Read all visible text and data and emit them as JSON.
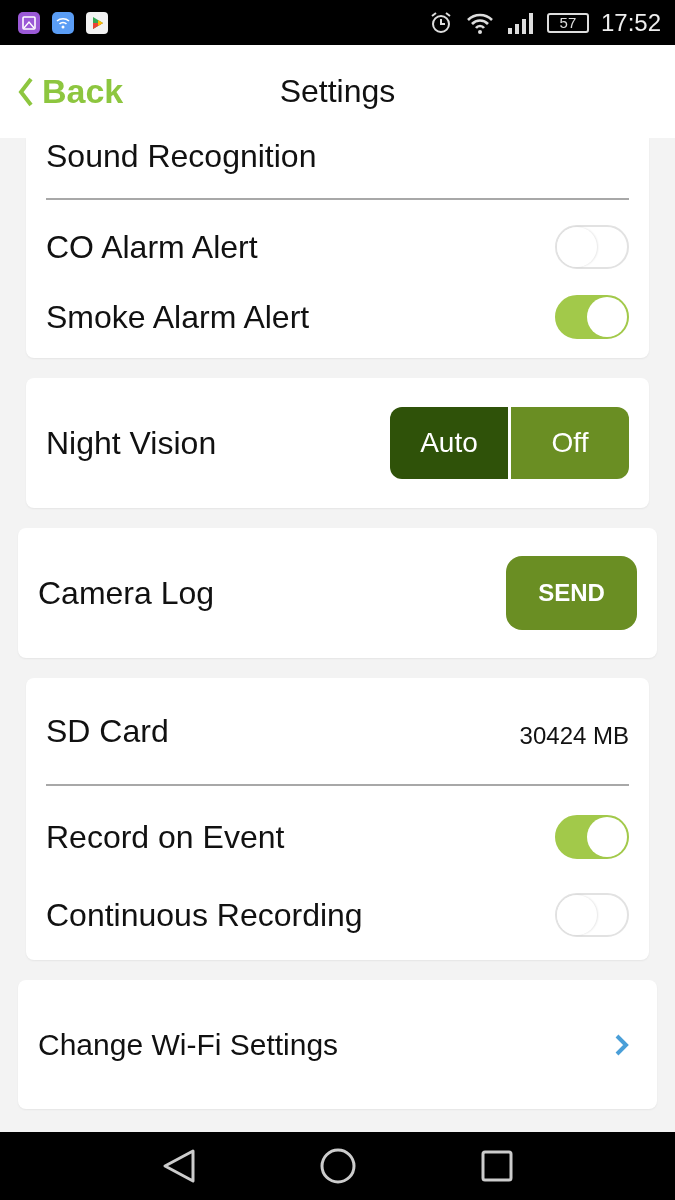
{
  "status_bar": {
    "battery": "57",
    "time": "17:52"
  },
  "header": {
    "back": "Back",
    "title": "Settings"
  },
  "cards": [
    {
      "cut_top": true,
      "rows": [
        {
          "kind": "heading",
          "label": "Sound Recognition"
        },
        {
          "kind": "toggle",
          "label": "CO Alarm Alert",
          "on": false
        },
        {
          "kind": "toggle",
          "label": "Smoke Alarm Alert",
          "on": true
        }
      ]
    },
    {
      "rows": [
        {
          "kind": "segmented",
          "label": "Night Vision",
          "options": [
            {
              "label": "Auto",
              "selected": true
            },
            {
              "label": "Off",
              "selected": false
            }
          ]
        }
      ]
    },
    {
      "wide": true,
      "rows": [
        {
          "kind": "button",
          "label": "Camera Log",
          "button": "SEND"
        }
      ]
    },
    {
      "rows": [
        {
          "kind": "heading_value",
          "label": "SD Card",
          "value": "30424 MB"
        },
        {
          "kind": "toggle",
          "label": "Record on Event",
          "on": true
        },
        {
          "kind": "toggle",
          "label": "Continuous Recording",
          "on": false
        }
      ]
    },
    {
      "wide": true,
      "rows": [
        {
          "kind": "link",
          "label": "Change Wi-Fi Settings"
        }
      ]
    }
  ]
}
